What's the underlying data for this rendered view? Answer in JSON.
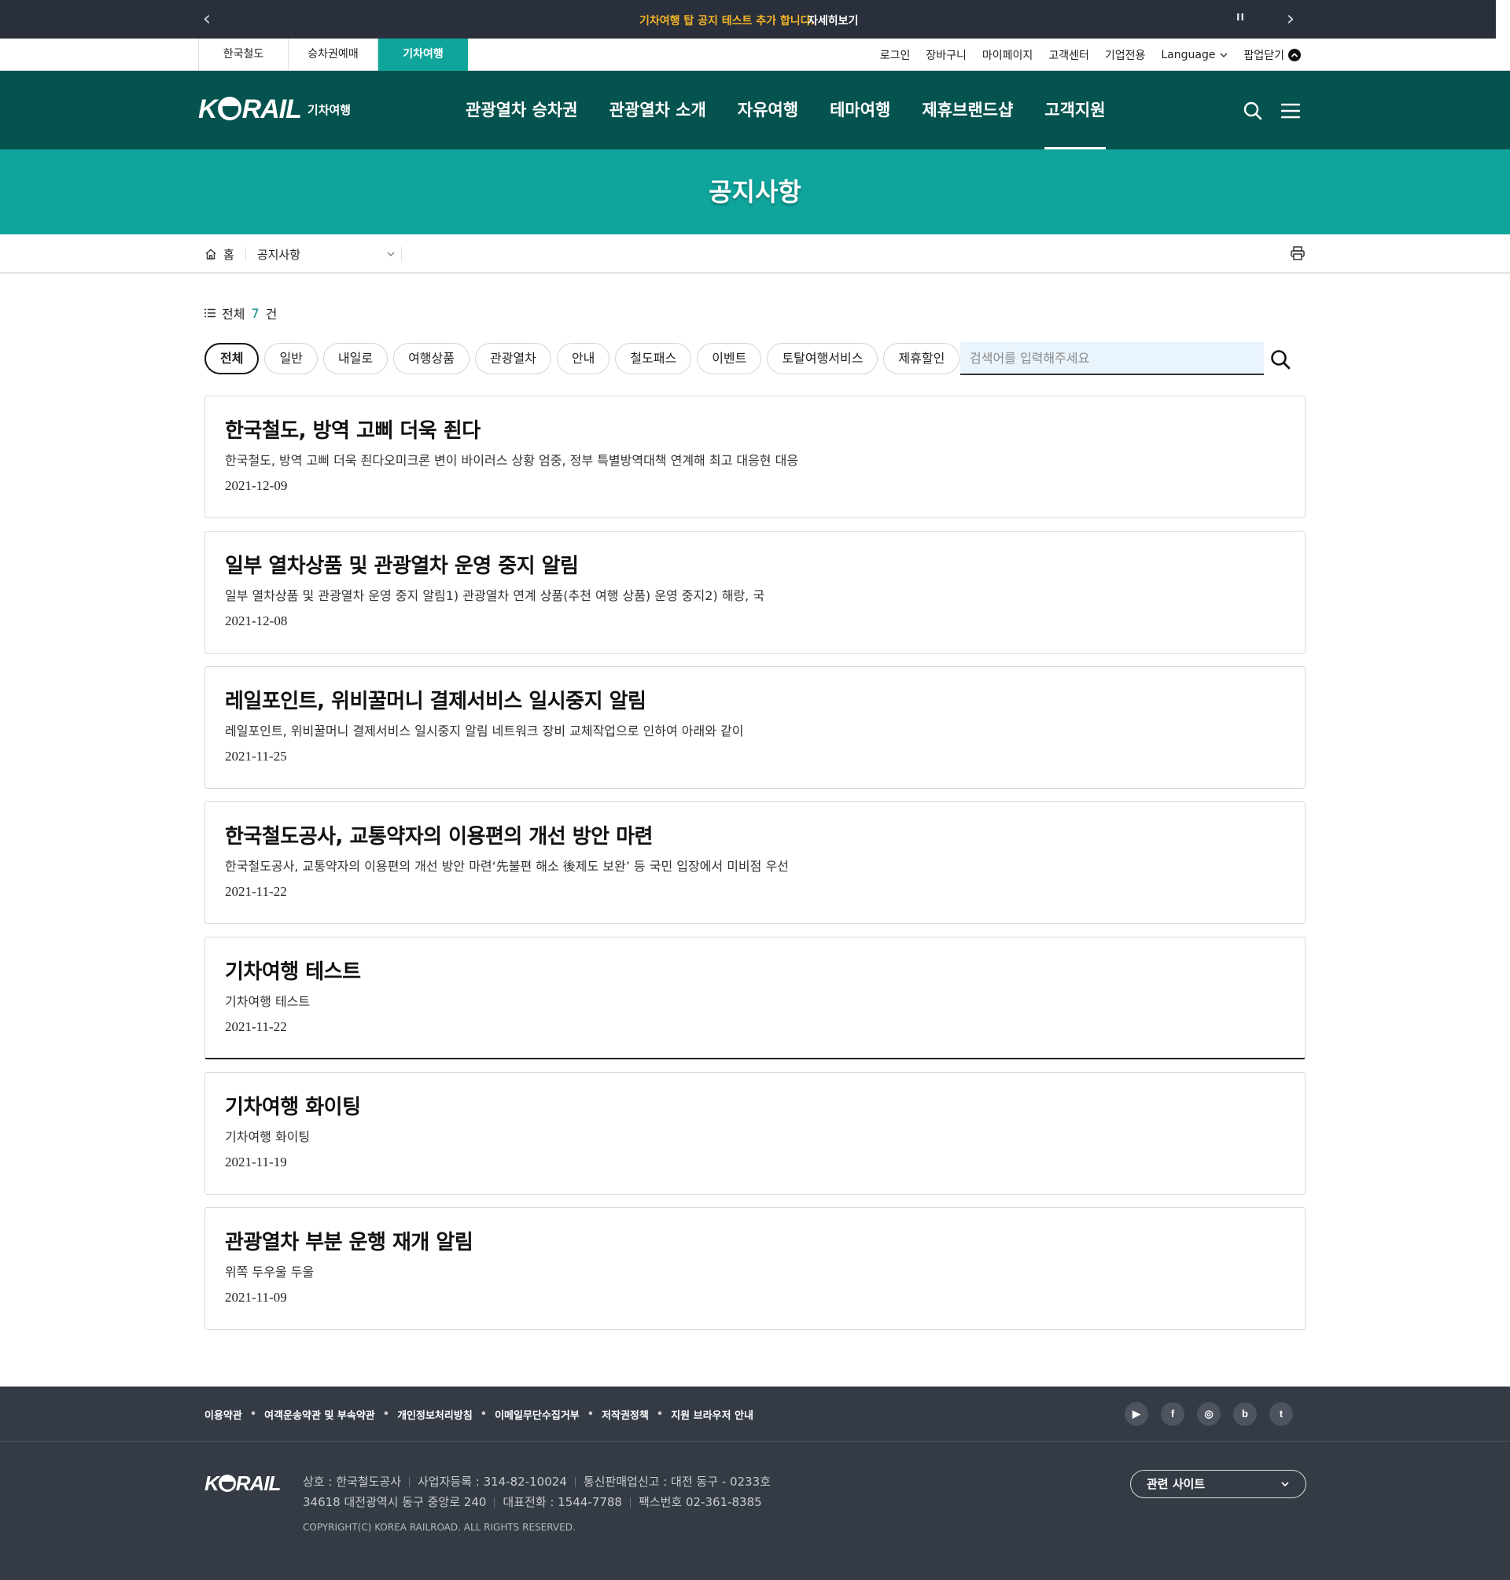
{
  "notice_bar": {
    "text": "기차여행 탑 공지 테스트 추가 합니다.",
    "link": "자세히보기",
    "pause": "II",
    "prev": "‹",
    "next": "›"
  },
  "site_tabs": [
    {
      "label": "한국철도"
    },
    {
      "label": "승차권예매"
    },
    {
      "label": "기차여행"
    }
  ],
  "util_links": {
    "login": "로그인",
    "cart": "장바구니",
    "mypage": "마이페이지",
    "customer_center": "고객센터",
    "corporate": "기업전용",
    "language": "Language",
    "popup_close": "팝업닫기"
  },
  "header": {
    "logo_sub": "기차여행",
    "nav": [
      {
        "label": "관광열차 승차권"
      },
      {
        "label": "관광열차 소개"
      },
      {
        "label": "자유여행"
      },
      {
        "label": "테마여행"
      },
      {
        "label": "제휴브랜드샵"
      },
      {
        "label": "고객지원"
      }
    ]
  },
  "page_title": "공지사항",
  "breadcrumb": {
    "home": "홈",
    "current": "공지사항"
  },
  "total": {
    "prefix": "전체",
    "count": "7",
    "suffix": "건"
  },
  "filters": [
    {
      "label": "전체"
    },
    {
      "label": "일반"
    },
    {
      "label": "내일로"
    },
    {
      "label": "여행상품"
    },
    {
      "label": "관광열차"
    },
    {
      "label": "안내"
    },
    {
      "label": "철도패스"
    },
    {
      "label": "이벤트"
    },
    {
      "label": "토탈여행서비스"
    },
    {
      "label": "제휴할인"
    }
  ],
  "search": {
    "placeholder": "검색어를 입력해주세요",
    "value": ""
  },
  "notices": [
    {
      "title": "한국철도, 방역 고삐 더욱 죈다",
      "summary": "한국철도, 방역 고삐 더욱 죈다오미크론 변이 바이러스 상황 엄중, 정부 특별방역대책 연계해 최고 대응현 대응",
      "date": "2021-12-09"
    },
    {
      "title": "일부 열차상품 및 관광열차 운영 중지 알림",
      "summary": "일부 열차상품 및 관광열차 운영 중지 알림1) 관광열차 연계 상품(추천 여행 상품) 운영 중지2) 해랑, 국",
      "date": "2021-12-08"
    },
    {
      "title": "레일포인트, 위비꿀머니 결제서비스 일시중지 알림",
      "summary": "레일포인트, 위비꿀머니 결제서비스 일시중지 알림 네트워크 장비 교체작업으로 인하여 아래와 같이",
      "date": "2021-11-25"
    },
    {
      "title": "한국철도공사, 교통약자의 이용편의 개선 방안 마련",
      "summary": "한국철도공사, 교통약자의 이용편의 개선 방안 마련‘先불편 해소 後제도 보완’ 등 국민 입장에서 미비점 우선",
      "date": "2021-11-22"
    },
    {
      "title": "기차여행 테스트",
      "summary": "기차여행 테스트",
      "date": "2021-11-22"
    },
    {
      "title": "기차여행 화이팅",
      "summary": "기차여행 화이팅",
      "date": "2021-11-19"
    },
    {
      "title": "관광열차 부분 운행 재개 알림",
      "summary": "위쪽 두우울  두울",
      "date": "2021-11-09"
    }
  ],
  "footer": {
    "links": [
      {
        "label": "이용약관"
      },
      {
        "label": "여객운송약관 및 부속약관"
      },
      {
        "label": "개인정보처리방침"
      },
      {
        "label": "이메일무단수집거부"
      },
      {
        "label": "저작권정책"
      },
      {
        "label": "지원 브라우저 안내"
      }
    ],
    "link_separator": "•",
    "social": [
      {
        "name": "youtube-icon",
        "glyph": "▶"
      },
      {
        "name": "facebook-icon",
        "glyph": "f"
      },
      {
        "name": "instagram-icon",
        "glyph": "◎"
      },
      {
        "name": "blog-icon",
        "glyph": "b"
      },
      {
        "name": "twitter-icon",
        "glyph": "t"
      }
    ],
    "company": "상호 : 한국철도공사",
    "business_no": "사업자등록 : 314-82-10024",
    "mail_order": "통신판매업신고 : 대전 동구 - 0233호",
    "address": "34618 대전광역시 동구 중앙로 240",
    "phone": "대표전화 : 1544-7788",
    "fax": "팩스번호 02-361-8385",
    "copyright": "COPYRIGHT(C) KOREA RAILROAD. ALL RIGHTS RESERVED.",
    "related_sites": "관련 사이트"
  },
  "colors": {
    "notice_bar_bg": "#29303b",
    "notice_text": "#f2b327",
    "header_bg": "#05534f",
    "accent_teal": "#0fa49c",
    "footer_bg": "#343b45"
  }
}
